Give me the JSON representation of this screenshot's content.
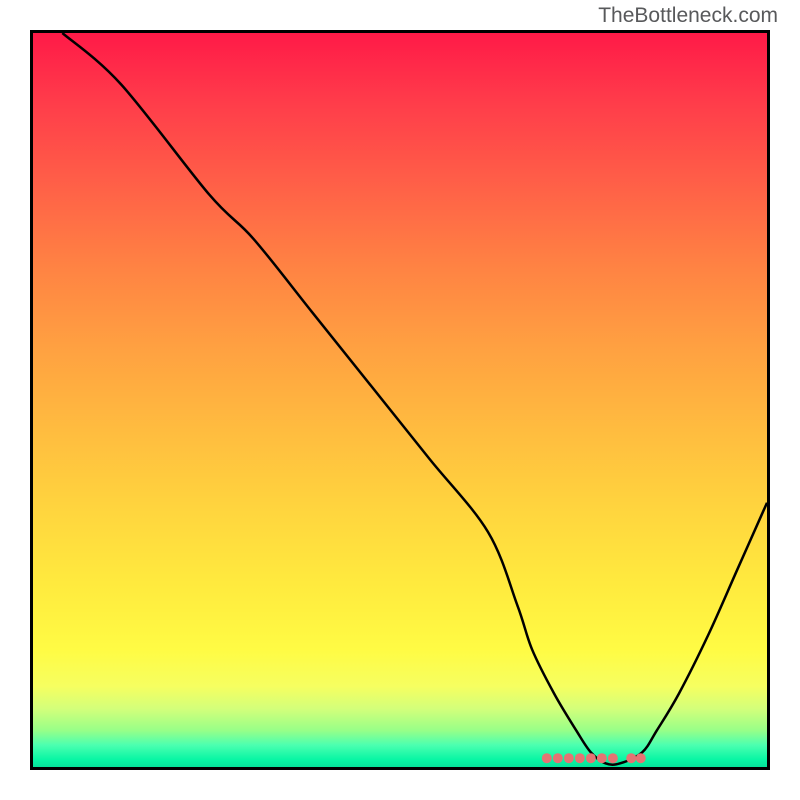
{
  "watermark": "TheBottleneck.com",
  "chart_data": {
    "type": "line",
    "title": "",
    "xlabel": "",
    "ylabel": "",
    "xlim": [
      0,
      100
    ],
    "ylim": [
      0,
      100
    ],
    "series": [
      {
        "name": "bottleneck-curve",
        "x": [
          4,
          12,
          24,
          30,
          38,
          46,
          54,
          62,
          66,
          68,
          71,
          74,
          76,
          78,
          80,
          83,
          85,
          88,
          92,
          96,
          100
        ],
        "values": [
          100,
          93,
          78,
          72,
          62,
          52,
          42,
          32,
          22,
          16,
          10,
          5,
          2,
          0.5,
          0.5,
          2,
          5,
          10,
          18,
          27,
          36
        ]
      }
    ],
    "markers": {
      "name": "highlight-dots",
      "color": "#e57373",
      "points": [
        {
          "x": 70,
          "y": 1.2
        },
        {
          "x": 71.5,
          "y": 1.2
        },
        {
          "x": 73,
          "y": 1.2
        },
        {
          "x": 74.5,
          "y": 1.2
        },
        {
          "x": 76,
          "y": 1.2
        },
        {
          "x": 77.5,
          "y": 1.2
        },
        {
          "x": 79,
          "y": 1.2
        },
        {
          "x": 81.5,
          "y": 1.2
        },
        {
          "x": 82.8,
          "y": 1.2
        }
      ]
    },
    "colors": {
      "top": "#ff1a48",
      "mid": "#ffd53e",
      "bottom": "#06e29a",
      "curve": "#000000",
      "marker": "#e57373"
    }
  }
}
